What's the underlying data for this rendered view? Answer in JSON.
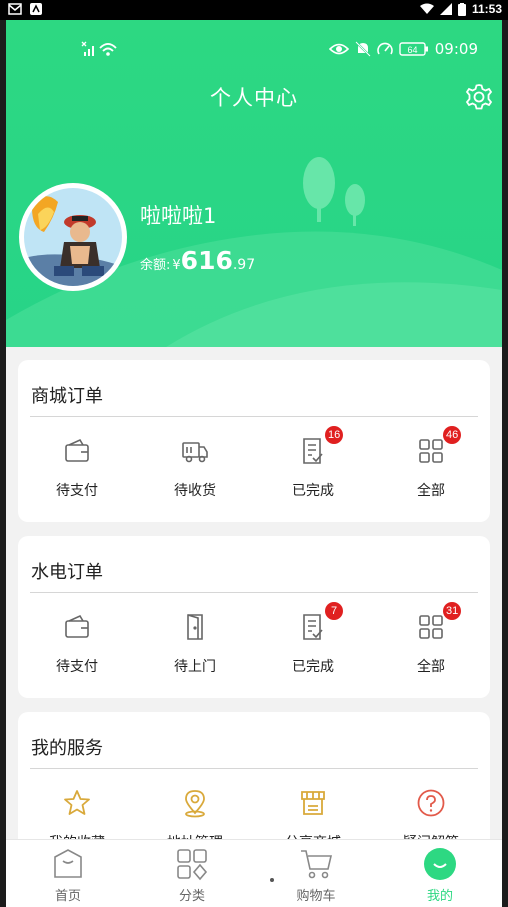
{
  "os_status": {
    "time": "11:53"
  },
  "status": {
    "time": "09:09",
    "battery": "64"
  },
  "header": {
    "title": "个人中心"
  },
  "profile": {
    "username": "啦啦啦1",
    "balance_label": "余额:",
    "currency": "¥",
    "balance_int": "616",
    "balance_dec": ".97"
  },
  "mall_orders": {
    "title": "商城订单",
    "items": [
      {
        "label": "待支付",
        "icon": "wallet-icon",
        "badge": ""
      },
      {
        "label": "待收货",
        "icon": "truck-icon",
        "badge": ""
      },
      {
        "label": "已完成",
        "icon": "checklist-icon",
        "badge": "16"
      },
      {
        "label": "全部",
        "icon": "grid-icon",
        "badge": "46"
      }
    ]
  },
  "utility_orders": {
    "title": "水电订单",
    "items": [
      {
        "label": "待支付",
        "icon": "wallet-icon",
        "badge": ""
      },
      {
        "label": "待上门",
        "icon": "door-icon",
        "badge": ""
      },
      {
        "label": "已完成",
        "icon": "checklist-icon",
        "badge": "7"
      },
      {
        "label": "全部",
        "icon": "grid-icon",
        "badge": "31"
      }
    ]
  },
  "services": {
    "title": "我的服务",
    "items": [
      {
        "label": "我的收藏",
        "icon": "star-icon"
      },
      {
        "label": "地址管理",
        "icon": "location-pin-icon"
      },
      {
        "label": "分享商城",
        "icon": "store-icon"
      },
      {
        "label": "疑问解答",
        "icon": "help-icon"
      }
    ]
  },
  "nav": {
    "items": [
      {
        "label": "首页",
        "icon": "home-icon",
        "active": false
      },
      {
        "label": "分类",
        "icon": "category-icon",
        "active": false
      },
      {
        "label": "购物车",
        "icon": "cart-icon",
        "active": false
      },
      {
        "label": "我的",
        "icon": "profile-icon",
        "active": true
      }
    ]
  },
  "colors": {
    "brand": "#2dd882",
    "badge": "#e02020",
    "icon_gold": "#d9a93b",
    "icon_red": "#e25a4a"
  }
}
